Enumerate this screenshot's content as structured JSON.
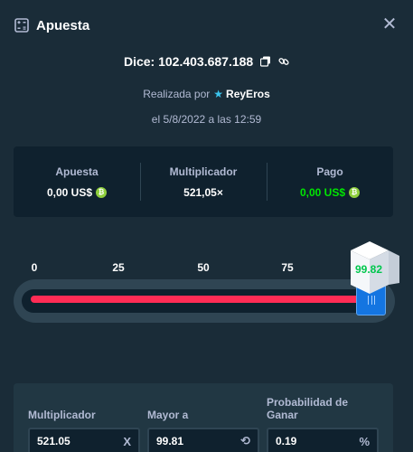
{
  "header": {
    "title": "Apuesta",
    "icon": "dice-icon"
  },
  "bet": {
    "dice_id": "Dice: 102.403.687.188",
    "placed_by_prefix": "Realizada por",
    "username": "ReyEros",
    "date": "el 5/8/2022 a las 12:59"
  },
  "stats": {
    "bet_label": "Apuesta",
    "bet_value": "0,00 US$",
    "multiplier_label": "Multiplicador",
    "multiplier_value": "521,05×",
    "payout_label": "Pago",
    "payout_value": "0,00 US$"
  },
  "slider": {
    "ticks": [
      "0",
      "25",
      "50",
      "75"
    ],
    "value": 99.81,
    "result": "99.82",
    "colors": {
      "lose": "#ff2c55",
      "handle": "#1475e1",
      "result_win": "#00c74d"
    }
  },
  "inputs": {
    "multiplier": {
      "label": "Multiplicador",
      "value": "521.05",
      "suffix": "X"
    },
    "roll_over": {
      "label": "Mayor a",
      "value": "99.81"
    },
    "win_chance": {
      "label_line1": "Probabilidad de",
      "label_line2": "Ganar",
      "value": "0.19",
      "suffix": "%"
    }
  }
}
